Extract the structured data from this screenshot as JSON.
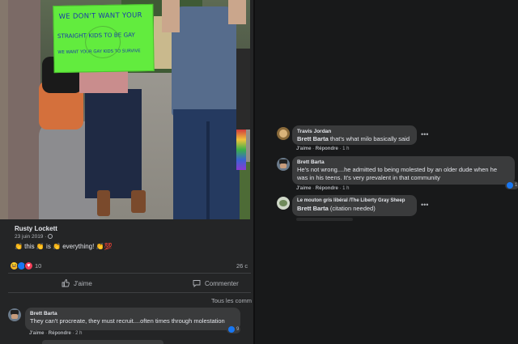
{
  "photo": {
    "sign_lines": [
      "WE DON'T WANT YOUR",
      "STRAIGHT KIDS TO BE GAY",
      "WE WANT YOUR GAY KIDS TO SURVIVE"
    ],
    "sign_color": "#62ec3e"
  },
  "post": {
    "author": "Rusty Lockett",
    "date": "23 juin 2019 · ",
    "text": "👏 this 👏 is 👏 everything! 👏💯",
    "reaction_count": "10",
    "comments_count": "26 c",
    "like_label": "J'aime",
    "comment_label": "Commenter",
    "sort_label": "Tous les comm"
  },
  "left_comment": {
    "name": "Brett Barta",
    "text": "They can't procreate, they must recruit....often times through molestation",
    "like": "J'aime",
    "reply": "Répondre",
    "time": "2 h",
    "likes": "9"
  },
  "comments": [
    {
      "name": "Travis Jordan",
      "mention": "Brett Barta",
      "text": " that's what milo basically said",
      "like": "J'aime",
      "reply": "Répondre",
      "time": "1 h"
    },
    {
      "name": "Brett Barta",
      "text_line1": "He's not wrong....he admitted to being molested by an older dude when he",
      "text_line2": "was in his teens. It's very prevalent in that community",
      "like": "J'aime",
      "reply": "Répondre",
      "time": "1 h",
      "likes": "1"
    },
    {
      "name": "Le mouton gris libéral /The Liberty Gray Sheep",
      "mention": "Brett Barta",
      "text": " (citation needed)"
    }
  ],
  "colors": {
    "background": "#18191a",
    "panel": "#242526",
    "bubble": "#3a3b3c",
    "accent": "#1877f2"
  }
}
